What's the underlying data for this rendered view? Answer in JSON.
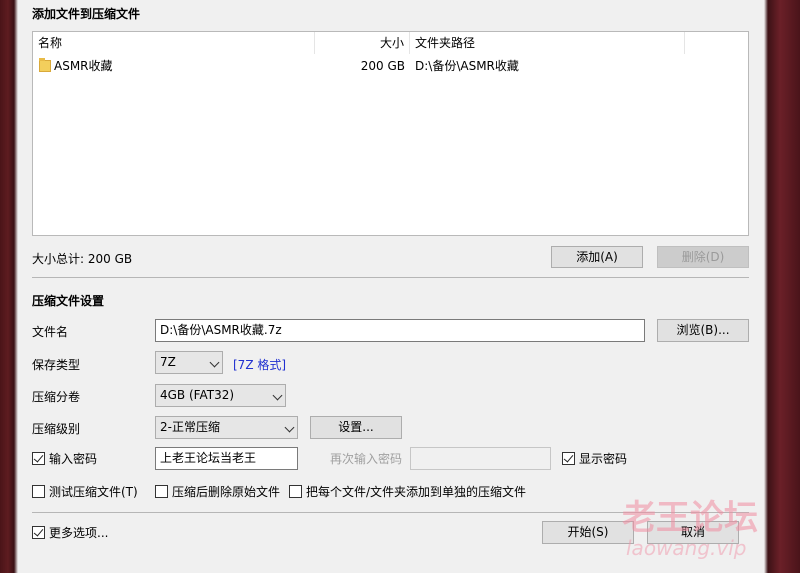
{
  "files_group": {
    "title": "添加文件到压缩文件",
    "columns": [
      "名称",
      "大小",
      "文件夹路径"
    ],
    "rows": [
      {
        "name": "ASMR收藏",
        "size": "200 GB",
        "path": "D:\\备份\\ASMR收藏",
        "icon": "folder-icon"
      }
    ],
    "total_label": "大小总计: 200 GB",
    "add_button": "添加(A)",
    "delete_button": "删除(D)"
  },
  "settings": {
    "title": "压缩文件设置",
    "filename_label": "文件名",
    "filename_value": "D:\\备份\\ASMR收藏.7z",
    "browse_button": "浏览(B)...",
    "type_label": "保存类型",
    "type_value": "7Z",
    "type_note": "[7Z 格式]",
    "split_label": "压缩分卷",
    "split_value": "4GB (FAT32)",
    "level_label": "压缩级别",
    "level_value": "2-正常压缩",
    "config_button": "设置...",
    "password_label": "输入密码",
    "password_checked": true,
    "password_value": "上老王论坛当老王",
    "reenter_label": "再次输入密码",
    "reenter_value": "",
    "show_password_label": "显示密码",
    "show_password_checked": true,
    "test_label": "测试压缩文件(T)",
    "delete_original_label": "压缩后删除原始文件",
    "each_separate_label": "把每个文件/文件夹添加到单独的压缩文件"
  },
  "footer": {
    "more_options_label": "更多选项...",
    "more_options_checked": true,
    "start_button": "开始(S)",
    "cancel_button": "取消"
  },
  "watermark": {
    "title": "老王论坛",
    "url": "laowang.vip"
  }
}
